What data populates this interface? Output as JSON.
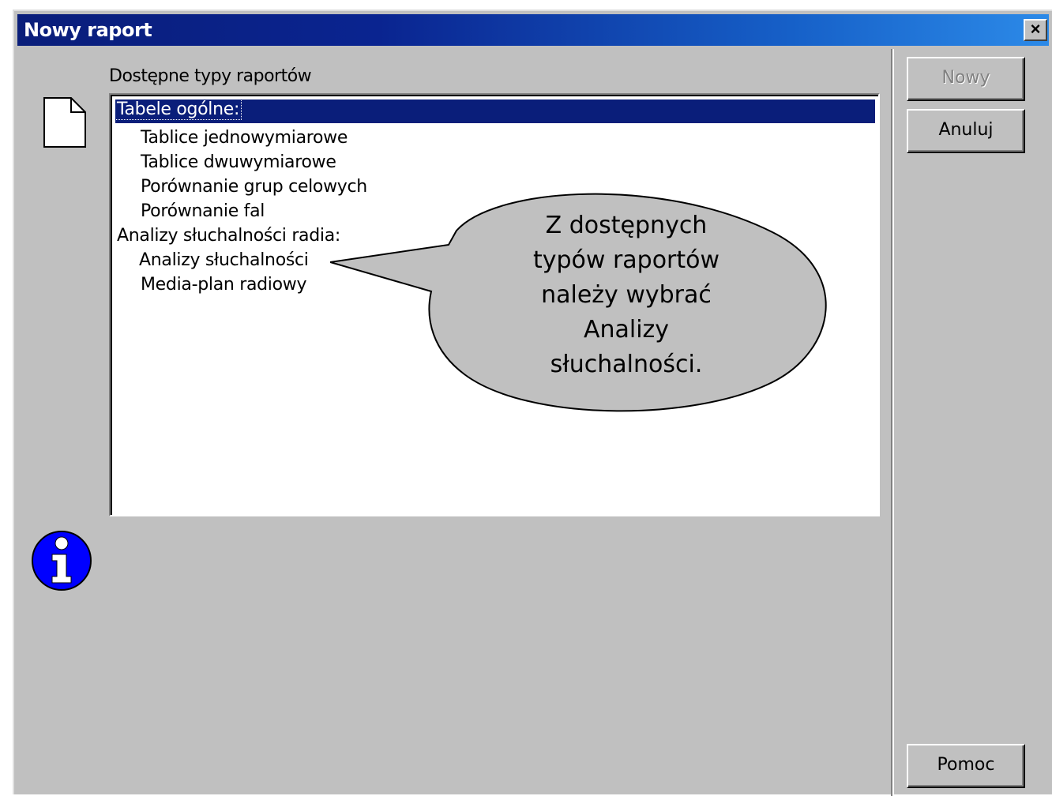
{
  "window": {
    "title": "Nowy raport",
    "close_symbol": "×"
  },
  "list": {
    "label": "Dostępne typy raportów",
    "items": [
      {
        "text": "Tabele ogólne:",
        "selected": true,
        "level": 0
      },
      {
        "text": "Tablice jednowymiarowe",
        "selected": false,
        "level": 1
      },
      {
        "text": "Tablice dwuwymiarowe",
        "selected": false,
        "level": 1
      },
      {
        "text": "Porównanie grup celowych",
        "selected": false,
        "level": 1
      },
      {
        "text": "Porównanie fal",
        "selected": false,
        "level": 1
      },
      {
        "text": "Analizy słuchalności radia:",
        "selected": false,
        "level": 0
      },
      {
        "text": "Analizy słuchalności",
        "selected": false,
        "level": 1
      },
      {
        "text": "Media-plan radiowy",
        "selected": false,
        "level": 1
      }
    ]
  },
  "buttons": {
    "new_label": "Nowy",
    "cancel_label": "Anuluj",
    "help_label": "Pomoc"
  },
  "callout": {
    "lines": [
      "Z dostępnych",
      "typów raportów",
      "należy wybrać",
      "Analizy",
      "słuchalności."
    ]
  },
  "icons": {
    "document": "document-icon",
    "info": "info-icon"
  },
  "colors": {
    "selection": "#0a1e7a",
    "dialog_bg": "#c0c0c0",
    "info_blue": "#0000ff"
  }
}
